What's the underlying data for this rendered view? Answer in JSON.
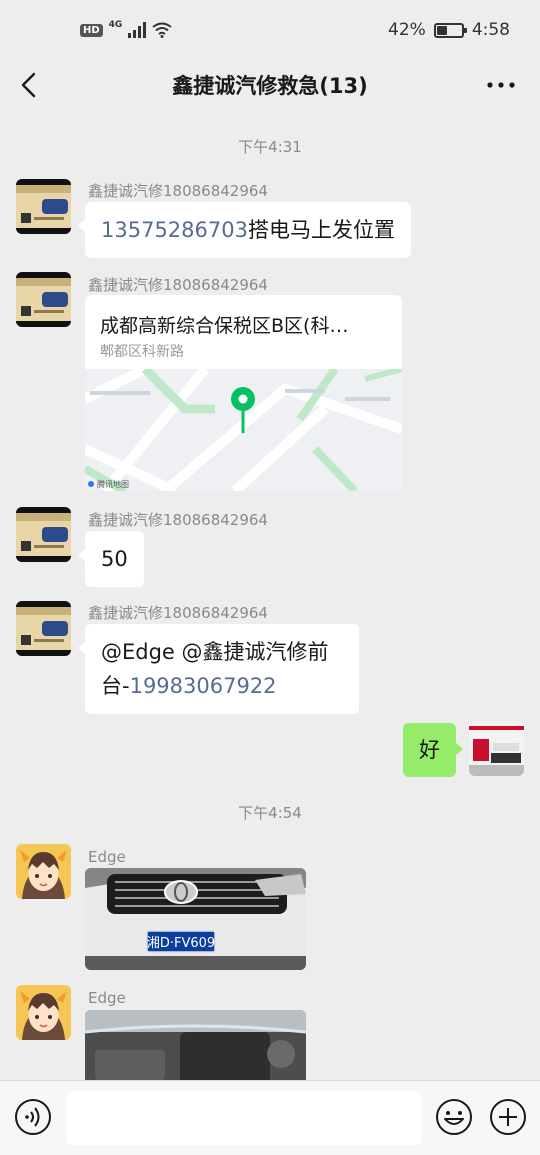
{
  "status_bar": {
    "hd": "HD",
    "network": "4G",
    "battery_percent": "42%",
    "battery_level": 0.42,
    "time": "4:58"
  },
  "nav": {
    "title": "鑫捷诚汽修救急(13)"
  },
  "chat": {
    "time_1": "下午4:31",
    "msg1": {
      "sender": "鑫捷诚汽修18086842964",
      "phone": "13575286703",
      "text": "搭电马上发位置"
    },
    "msg2": {
      "sender": "鑫捷诚汽修18086842964",
      "location_name": "成都高新综合保税区B区(科…",
      "location_address": "郫都区科新路",
      "map_provider": "腾讯地图"
    },
    "msg3": {
      "sender": "鑫捷诚汽修18086842964",
      "text": "50"
    },
    "msg4": {
      "sender": "鑫捷诚汽修18086842964",
      "text_line1": "@Edge @鑫捷诚汽修前",
      "text_prefix": "台-",
      "phone": "19983067922"
    },
    "msg5": {
      "text": "好"
    },
    "time_2": "下午4:54",
    "msg6": {
      "sender": "Edge",
      "plate": "湘D·FV609"
    },
    "msg7": {
      "sender": "Edge"
    }
  },
  "colors": {
    "background": "#ededed",
    "my_bubble": "#95ec69",
    "link": "#576b95",
    "map_pin": "#07c160"
  }
}
